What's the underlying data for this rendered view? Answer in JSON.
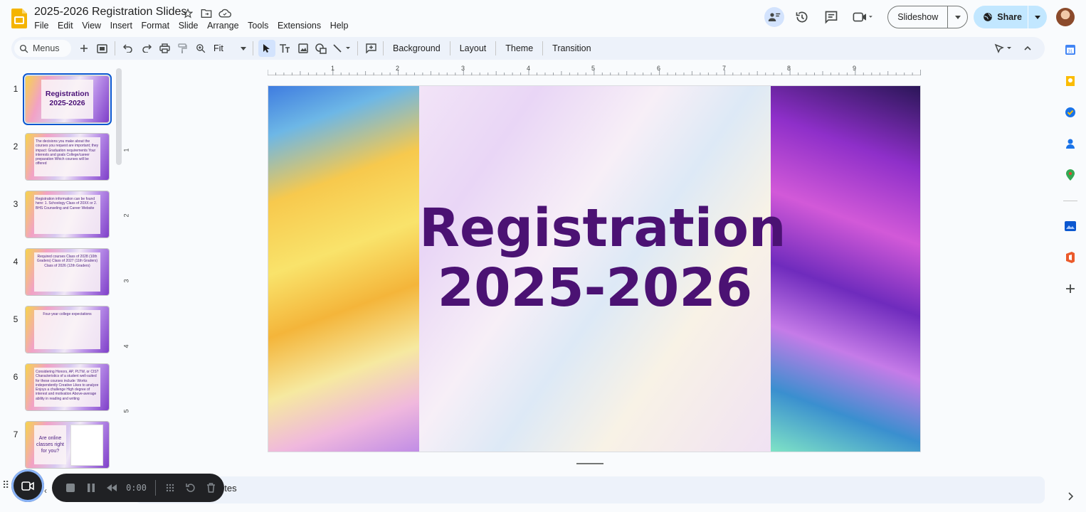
{
  "app": {
    "title": "2025-2026 Registration Slides",
    "menus": [
      "File",
      "Edit",
      "View",
      "Insert",
      "Format",
      "Slide",
      "Arrange",
      "Tools",
      "Extensions",
      "Help"
    ],
    "slideshow_label": "Slideshow",
    "share_label": "Share"
  },
  "toolbar": {
    "search_label": "Menus",
    "zoom_label": "Fit",
    "background_label": "Background",
    "layout_label": "Layout",
    "theme_label": "Theme",
    "transition_label": "Transition"
  },
  "ruler": {
    "h_numbers": [
      "1",
      "2",
      "3",
      "4",
      "5",
      "6",
      "7",
      "8",
      "9"
    ],
    "v_numbers": [
      "1",
      "2",
      "3",
      "4",
      "5"
    ]
  },
  "slides": [
    {
      "num": "1",
      "title": "Registration 2025-2026"
    },
    {
      "num": "2",
      "text": "The decisions you make about the courses you request are important; they impact: Graduation requirements Your interests and goals College/career preparation Which courses will be offered"
    },
    {
      "num": "3",
      "text": "Registration information can be found here: 1. Schoology Class of 20XX or 2. BHS Counseling and Career Website"
    },
    {
      "num": "4",
      "text": "Required courses Class of 2028 (10th Graders) Class of 2027 (11th Graders) Class of 2026 (12th Graders)"
    },
    {
      "num": "5",
      "text": "Four-year college expectations"
    },
    {
      "num": "6",
      "text": "Considering Honors, AP, PLTW, or CIS? Characteristics of a student well-suited for these courses include: Works independently Creative Likes to analyze Enjoys a challenge High degree of interest and motivation Above-average ability in reading and writing"
    },
    {
      "num": "7",
      "text": "Are online classes right for you?"
    }
  ],
  "main_slide": {
    "line1": "Registration",
    "line2": "2025-2026"
  },
  "notes_label": "otes",
  "recorder": {
    "time": "0:00"
  },
  "colors": {
    "accent": "#0b57d0",
    "share_bg": "#c2e7ff",
    "title_text": "#4b1273"
  }
}
